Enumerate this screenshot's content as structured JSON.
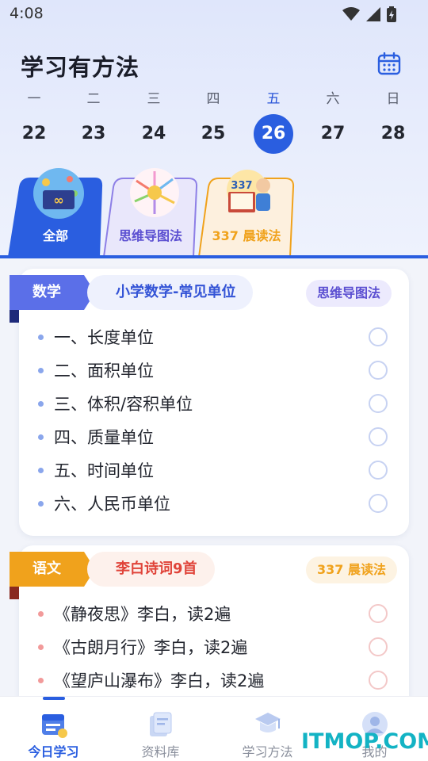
{
  "status_bar": {
    "time": "4:08"
  },
  "header": {
    "title": "学习有方法"
  },
  "week": {
    "weekdays": [
      "一",
      "二",
      "三",
      "四",
      "五",
      "六",
      "日"
    ],
    "dates": [
      "22",
      "23",
      "24",
      "25",
      "26",
      "27",
      "28"
    ],
    "active_index": 4
  },
  "tabs": [
    {
      "label": "全部"
    },
    {
      "label": "思维导图法"
    },
    {
      "label": "337 晨读法"
    }
  ],
  "cards": [
    {
      "subject": "数学",
      "topic": "小学数学-常见单位",
      "method": "思维导图法",
      "items": [
        "一、长度单位",
        "二、面积单位",
        "三、体积/容积单位",
        "四、质量单位",
        "五、时间单位",
        "六、人民币单位"
      ]
    },
    {
      "subject": "语文",
      "topic": "李白诗词9首",
      "method": "337 晨读法",
      "items": [
        "《静夜思》李白，读2遍",
        "《古朗月行》李白，读2遍",
        "《望庐山瀑布》李白，读2遍"
      ]
    }
  ],
  "bottom_nav": [
    {
      "label": "今日学习"
    },
    {
      "label": "资料库"
    },
    {
      "label": "学习方法"
    },
    {
      "label": "我的"
    }
  ],
  "watermark": "ITMOP.COM",
  "colors": {
    "accent": "#2a5ee0",
    "math": "#5b6fe8",
    "chinese": "#f0a21c",
    "chinese_topic": "#e0443a"
  }
}
